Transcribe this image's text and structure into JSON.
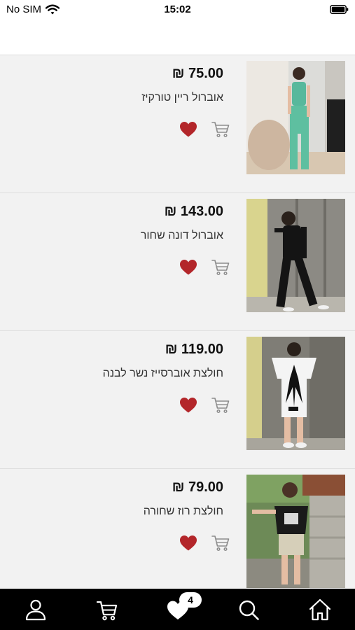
{
  "status_bar": {
    "carrier": "No SIM",
    "time": "15:02"
  },
  "products": [
    {
      "price": "₪ 75.00",
      "name": "אוברול ריין טורקיז",
      "image": "girl-turquoise-jumpsuit"
    },
    {
      "price": "₪ 143.00",
      "name": "אוברול דונה שחור",
      "image": "girl-black-jumpsuit"
    },
    {
      "price": "₪ 119.00",
      "name": "חולצת אוברסייז נשר לבנה",
      "image": "girl-white-eagle-shirt"
    },
    {
      "price": "₪ 79.00",
      "name": "חולצת רוז שחורה",
      "image": "girl-black-rose-shirt"
    }
  ],
  "nav": {
    "items": [
      "user-icon",
      "cart-icon",
      "heart-icon",
      "search-icon",
      "home-icon"
    ],
    "favorites_count": "4"
  },
  "colors": {
    "heart": "#b3262a",
    "cart_outline": "#8c8c8c",
    "list_background": "#f2f2f2",
    "nav_background": "#000000"
  }
}
